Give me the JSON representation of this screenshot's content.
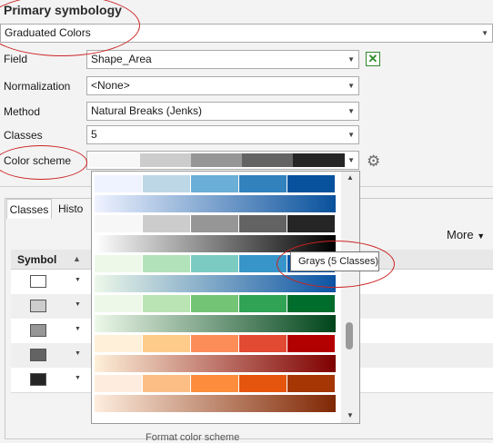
{
  "section": {
    "title": "Primary symbology"
  },
  "symbology": {
    "type": "Graduated Colors"
  },
  "fields": {
    "field_label": "Field",
    "field_value": "Shape_Area",
    "norm_label": "Normalization",
    "norm_value": "<None>",
    "method_label": "Method",
    "method_value": "Natural Breaks (Jenks)",
    "classes_label": "Classes",
    "classes_value": "5",
    "color_label": "Color scheme"
  },
  "tabs": [
    "Classes",
    "Histo"
  ],
  "more_label": "More",
  "grid": {
    "symbol_header": "Symbol",
    "swatches": [
      "#ffffff",
      "#cccccc",
      "#969696",
      "#636363",
      "#252525"
    ]
  },
  "tooltip": "Grays (5 Classes)",
  "footer_label": "Format color scheme",
  "ramps": {
    "selected": [
      "#f7f7f7",
      "#cccccc",
      "#969696",
      "#636363",
      "#252525"
    ],
    "list": [
      {
        "discrete": [
          "#eff3ff",
          "#bdd7e7",
          "#6baed6",
          "#3182bd",
          "#08519c"
        ],
        "grad": [
          "#eff3ff",
          "#08519c"
        ]
      },
      {
        "discrete": [
          "#f7f7f7",
          "#cccccc",
          "#969696",
          "#636363",
          "#252525"
        ],
        "grad": [
          "#ffffff",
          "#000000"
        ]
      },
      {
        "discrete": [
          "#edf8e9",
          "#b2e2b9",
          "#7ccbc2",
          "#3795c9",
          "#0b53a3"
        ],
        "grad": [
          "#edf8e9",
          "#0b53a3"
        ]
      },
      {
        "discrete": [
          "#edf8e9",
          "#bae4b3",
          "#74c476",
          "#31a354",
          "#006d2c"
        ],
        "grad": [
          "#edf8e9",
          "#00441b"
        ]
      },
      {
        "discrete": [
          "#fef0d9",
          "#fdcc8a",
          "#fc8d59",
          "#e34a33",
          "#b30000"
        ],
        "grad": [
          "#fef0d9",
          "#7f0000"
        ]
      },
      {
        "discrete": [
          "#feedde",
          "#fdbe85",
          "#fd8d3c",
          "#e6550d",
          "#a63603"
        ],
        "grad": [
          "#feedde",
          "#7f2704"
        ]
      }
    ]
  }
}
